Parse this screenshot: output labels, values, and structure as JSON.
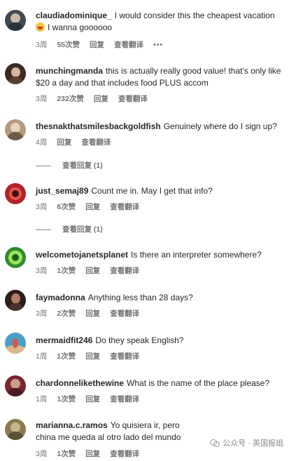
{
  "comments": [
    {
      "username": "claudiadominique_",
      "text": "I would consider this the cheapest vacation",
      "text2": "I wanna goooooo",
      "emoji": "grinning-face",
      "time": "3周",
      "likes": "55次赞",
      "reply": "回复",
      "translate": "查看翻译",
      "more": "•••",
      "avatar_colors": [
        "#3f4a52",
        "#c9b7a3"
      ]
    },
    {
      "username": "munchingmanda",
      "text": "this is actually really good value! that's only like $20 a day and that includes food PLUS accom",
      "time": "3周",
      "likes": "232次赞",
      "reply": "回复",
      "translate": "查看翻译",
      "avatar_colors": [
        "#3b2a22",
        "#d7b59c"
      ]
    },
    {
      "username": "thesnakthatsmilesbackgoldfish",
      "text": "Genuinely where do I sign up?",
      "time": "4周",
      "reply": "回复",
      "translate": "查看翻译",
      "view_replies": "查看回复 (1)",
      "avatar_colors": [
        "#b59a7c",
        "#6e5846"
      ]
    },
    {
      "username": "just_semaj89",
      "text": "Count me in. May I get that info?",
      "time": "3周",
      "likes": "6次赞",
      "reply": "回复",
      "translate": "查看翻译",
      "view_replies": "查看回复 (1)",
      "avatar_colors": [
        "#b3202a",
        "#e05848"
      ]
    },
    {
      "username": "welcometojanetsplanet",
      "text": "Is there an interpreter somewhere?",
      "time": "3周",
      "likes": "1次赞",
      "reply": "回复",
      "translate": "查看翻译",
      "avatar_colors": [
        "#2e8b2f",
        "#9be35b"
      ]
    },
    {
      "username": "faymadonna",
      "text": "Anything less than 28 days?",
      "time": "3周",
      "likes": "2次赞",
      "reply": "回复",
      "translate": "查看翻译",
      "avatar_colors": [
        "#2a1d1a",
        "#b27a62"
      ]
    },
    {
      "username": "mermaidfit246",
      "text": "Do they speak English?",
      "time": "1周",
      "likes": "1次赞",
      "reply": "回复",
      "translate": "查看翻译",
      "avatar_colors": [
        "#4aa0c9",
        "#d9564a"
      ]
    },
    {
      "username": "chardonnelikethewine",
      "text": "What is the name of the place please?",
      "time": "1周",
      "likes": "1次赞",
      "reply": "回复",
      "translate": "查看翻译",
      "avatar_colors": [
        "#7b2530",
        "#c9a08a"
      ]
    },
    {
      "username": "marianna.c.ramos",
      "text": "Yo quisiera ir, pero china me queda al otro lado del mundo",
      "time": "3周",
      "likes": "1次赞",
      "reply": "回复",
      "translate": "查看翻译",
      "avatar_colors": [
        "#8b7a4f",
        "#c7b58a"
      ]
    }
  ],
  "watermark": "公众号 · 英国报姐"
}
